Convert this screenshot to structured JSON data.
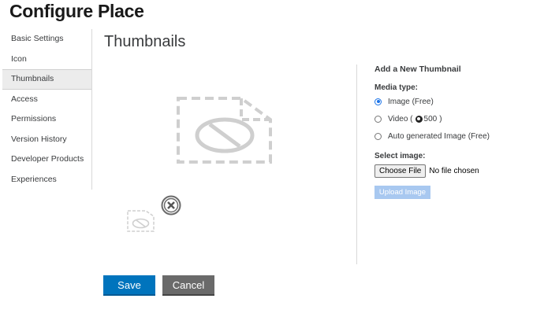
{
  "page": {
    "title": "Configure Place"
  },
  "sidebar": {
    "items": [
      {
        "label": "Basic Settings"
      },
      {
        "label": "Icon"
      },
      {
        "label": "Thumbnails",
        "active": true
      },
      {
        "label": "Access"
      },
      {
        "label": "Permissions"
      },
      {
        "label": "Version History"
      },
      {
        "label": "Developer Products"
      },
      {
        "label": "Experiences"
      }
    ]
  },
  "main": {
    "section_title": "Thumbnails",
    "thumbnail_placeholder_icon": "image-placeholder-icon",
    "remove_icon": "close-circle-icon"
  },
  "add_thumbnail": {
    "title": "Add a New Thumbnail",
    "media_type_label": "Media type:",
    "options": [
      {
        "label": "Image (Free)",
        "checked": true
      },
      {
        "label_prefix": "Video (",
        "price": "500",
        "label_suffix": ")",
        "checked": false
      },
      {
        "label": "Auto generated Image (Free)",
        "checked": false
      }
    ],
    "select_image_label": "Select image:",
    "choose_file_label": "Choose File",
    "no_file_text": "No file chosen",
    "upload_label": "Upload Image"
  },
  "actions": {
    "save_label": "Save",
    "cancel_label": "Cancel"
  },
  "colors": {
    "primary": "#0074bd",
    "secondary": "#6a6a6a",
    "upload_disabled": "#a8c8f0",
    "radio_checked": "#1a73e8"
  }
}
